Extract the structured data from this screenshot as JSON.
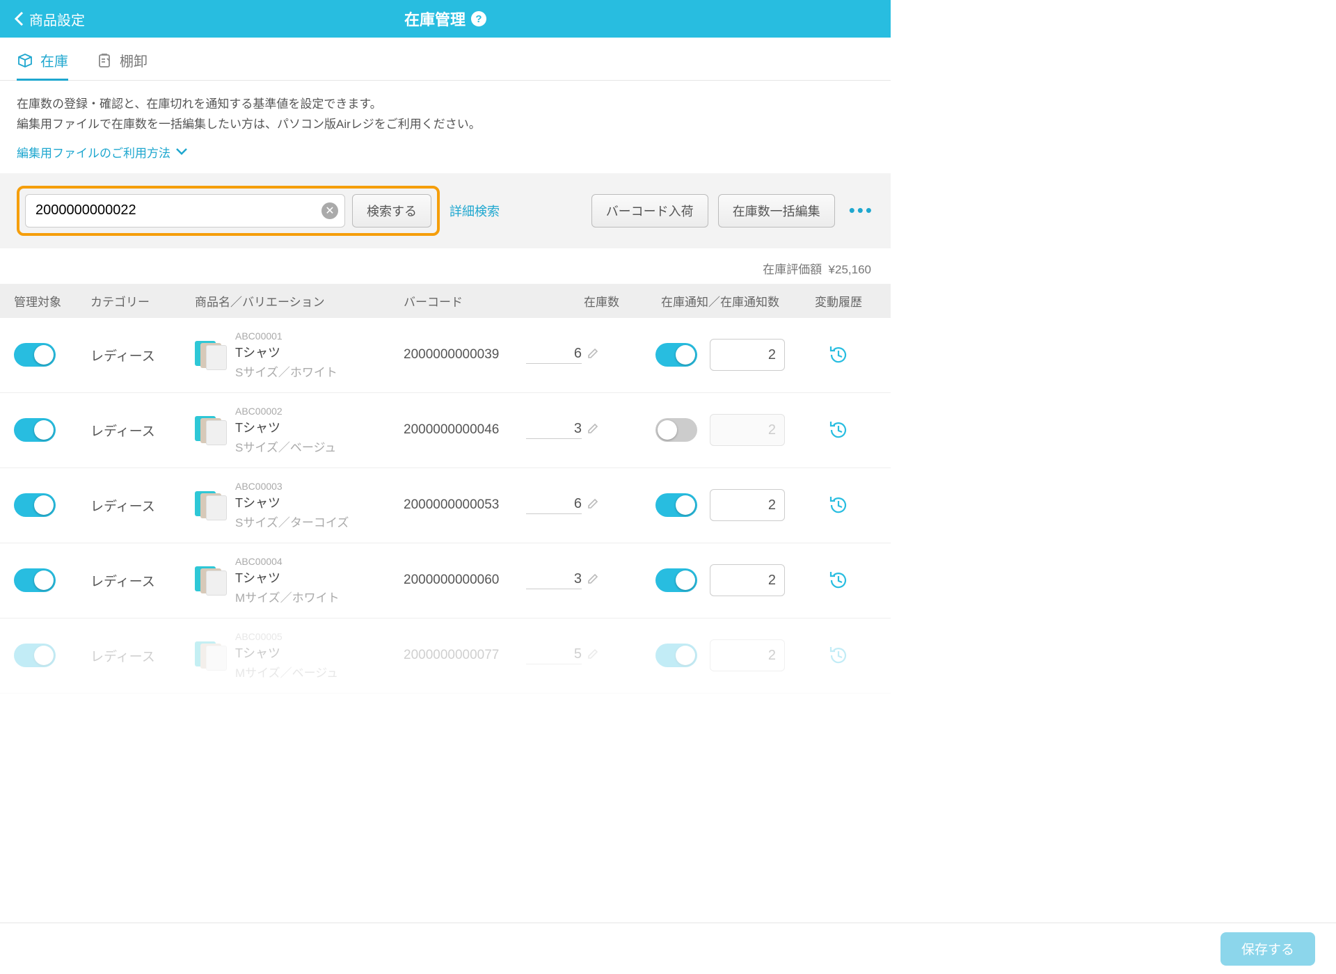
{
  "header": {
    "back_label": "商品設定",
    "title": "在庫管理"
  },
  "tabs": {
    "stock": "在庫",
    "inventory": "棚卸"
  },
  "info": {
    "line1": "在庫数の登録・確認と、在庫切れを通知する基準値を設定できます。",
    "line2": "編集用ファイルで在庫数を一括編集したい方は、パソコン版Airレジをご利用ください。",
    "link": "編集用ファイルのご利用方法"
  },
  "toolbar": {
    "search_value": "2000000000022",
    "search_button": "検索する",
    "advanced_search": "詳細検索",
    "barcode_button": "バーコード入荷",
    "bulk_edit_button": "在庫数一括編集"
  },
  "valuation": {
    "label": "在庫評価額",
    "value": "¥25,160"
  },
  "columns": {
    "manage": "管理対象",
    "category": "カテゴリー",
    "product": "商品名／バリエーション",
    "barcode": "バーコード",
    "stock": "在庫数",
    "notify": "在庫通知／在庫通知数",
    "history": "変動履歴"
  },
  "rows": [
    {
      "manage": true,
      "category": "レディース",
      "sku": "ABC00001",
      "name": "Tシャツ",
      "variation": "Sサイズ／ホワイト",
      "barcode": "2000000000039",
      "stock": "6",
      "notify_on": true,
      "notify_value": "2",
      "faded": false
    },
    {
      "manage": true,
      "category": "レディース",
      "sku": "ABC00002",
      "name": "Tシャツ",
      "variation": "Sサイズ／ベージュ",
      "barcode": "2000000000046",
      "stock": "3",
      "notify_on": false,
      "notify_value": "2",
      "faded": false
    },
    {
      "manage": true,
      "category": "レディース",
      "sku": "ABC00003",
      "name": "Tシャツ",
      "variation": "Sサイズ／ターコイズ",
      "barcode": "2000000000053",
      "stock": "6",
      "notify_on": true,
      "notify_value": "2",
      "faded": false
    },
    {
      "manage": true,
      "category": "レディース",
      "sku": "ABC00004",
      "name": "Tシャツ",
      "variation": "Mサイズ／ホワイト",
      "barcode": "2000000000060",
      "stock": "3",
      "notify_on": true,
      "notify_value": "2",
      "faded": false
    },
    {
      "manage": true,
      "category": "レディース",
      "sku": "ABC00005",
      "name": "Tシャツ",
      "variation": "Mサイズ／ベージュ",
      "barcode": "2000000000077",
      "stock": "5",
      "notify_on": true,
      "notify_value": "2",
      "faded": true
    }
  ],
  "footer": {
    "save": "保存する"
  }
}
